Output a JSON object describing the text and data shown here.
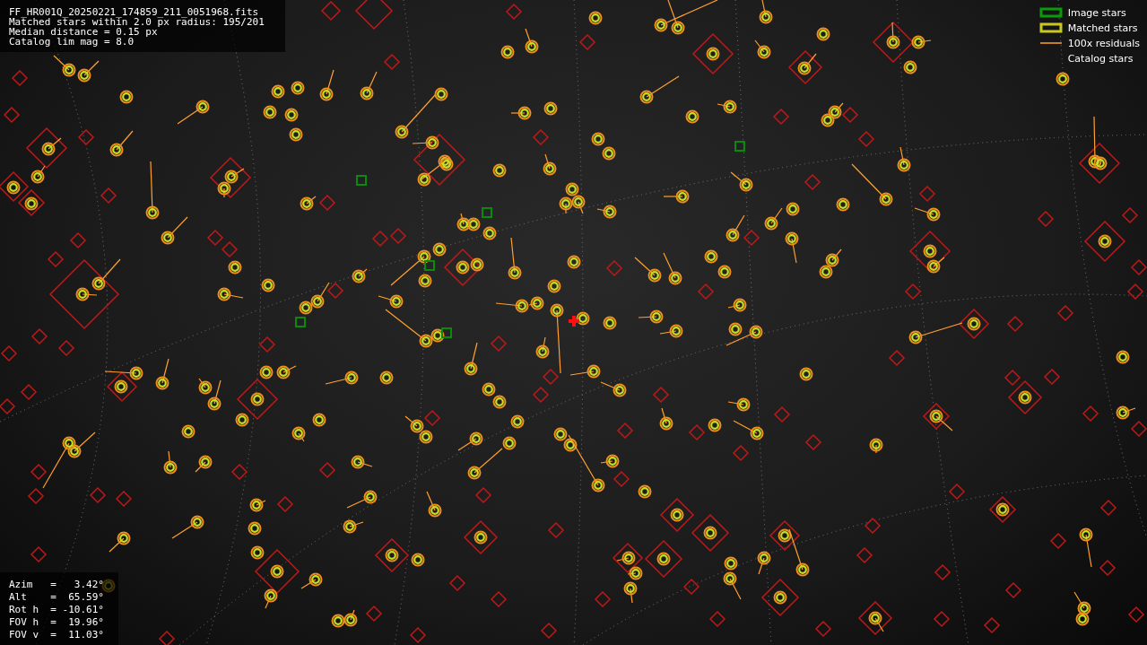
{
  "header_info": [
    "FF_HR001Q_20250221_174859_211_0051968.fits",
    "Matched stars within 2.0 px radius: 195/201",
    "Median distance = 0.15 px",
    "Catalog lim mag = 8.0"
  ],
  "legend": [
    {
      "kind": "image",
      "label": "Image stars"
    },
    {
      "kind": "matched",
      "label": "Matched stars"
    },
    {
      "kind": "residual",
      "label": "100x residuals"
    },
    {
      "kind": "catalog",
      "label": "Catalog stars"
    }
  ],
  "pointing_info": [
    "Azim   =   3.42°",
    "Alt    =  65.59°",
    "Rot h  = -10.61°",
    "FOV h  =  19.96°",
    "FOV v  =  11.03°"
  ]
}
